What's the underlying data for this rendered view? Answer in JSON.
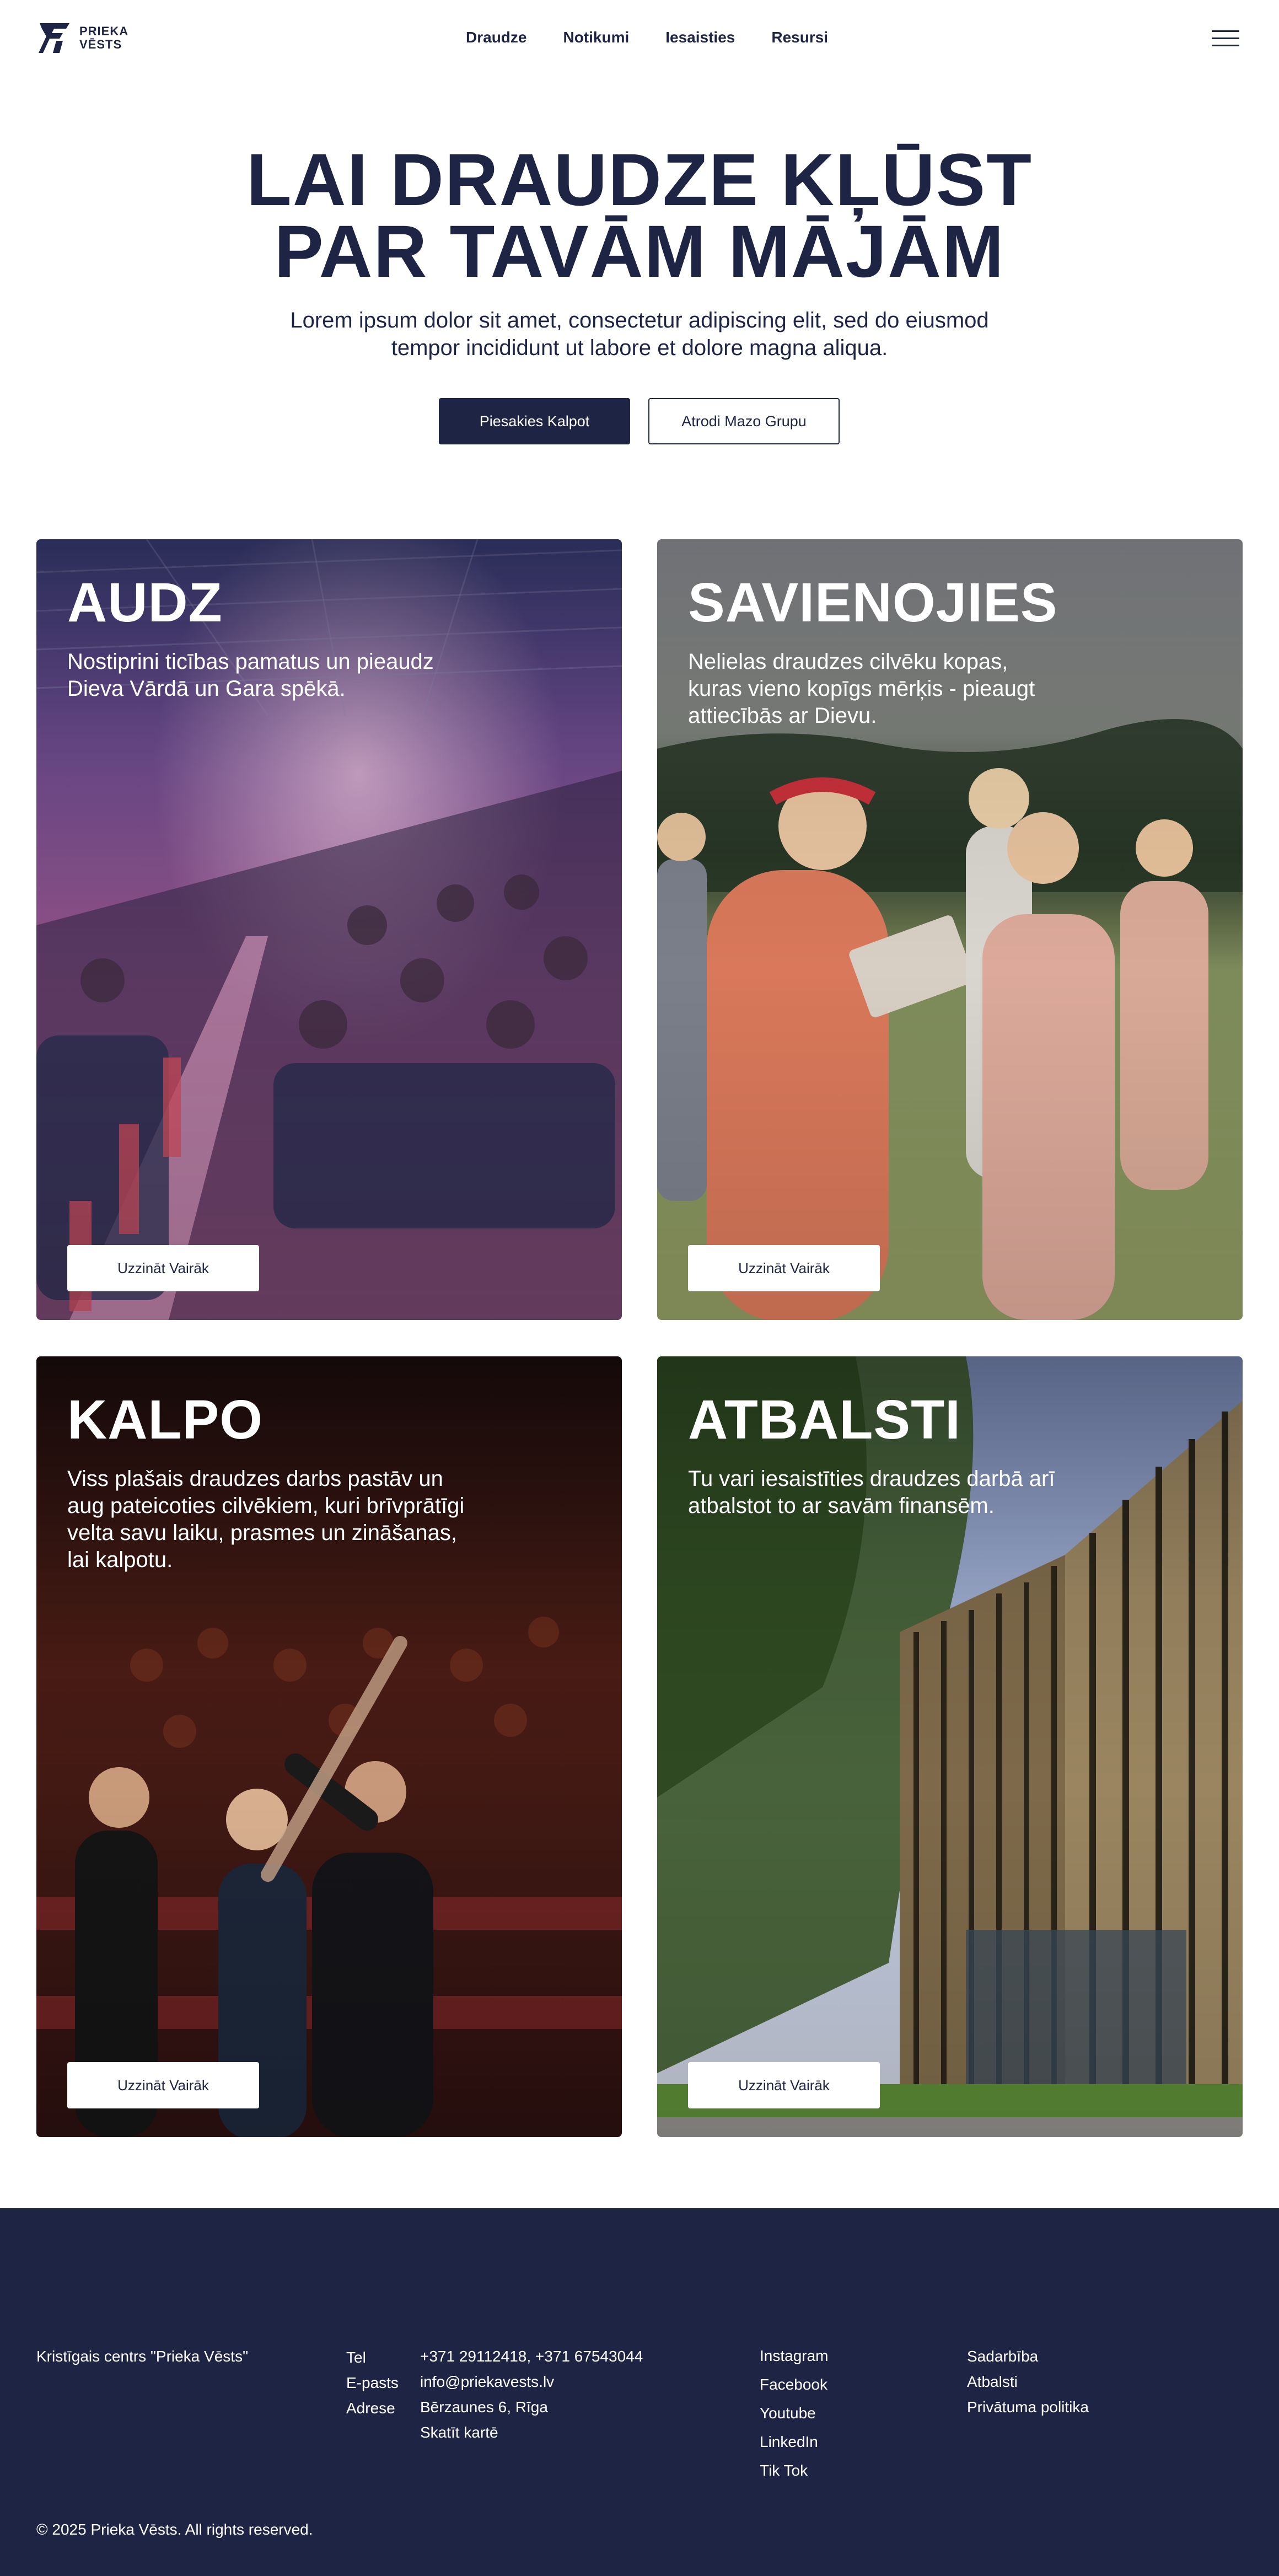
{
  "brand": {
    "logo_line1": "PRIEKA",
    "logo_line2": "VĒSTS"
  },
  "nav": {
    "items": [
      "Draudze",
      "Notikumi",
      "Iesaisties",
      "Resursi"
    ]
  },
  "hero": {
    "title_line1": "LAI DRAUDZE KĻŪST",
    "title_line2": "PAR TAVĀM MĀJĀM",
    "subtitle_line1": "Lorem ipsum dolor sit amet, consectetur adipiscing elit, sed do eiusmod",
    "subtitle_line2": "tempor incididunt ut labore et dolore magna aliqua.",
    "btn_primary": "Piesakies Kalpot",
    "btn_secondary": "Atrodi Mazo Grupu"
  },
  "cards": [
    {
      "title": "AUDZ",
      "text": "Nostiprini ticības pamatus un pieaudz Dieva Vārdā un Gara spēkā.",
      "button": "Uzzināt Vairāk"
    },
    {
      "title": "SAVIENOJIES",
      "text": "Nelielas draudzes cilvēku kopas, kuras vieno kopīgs mērķis - pieaugt attiecībās ar Dievu.",
      "button": "Uzzināt Vairāk"
    },
    {
      "title": "KALPO",
      "text": "Viss plašais draudzes darbs pastāv un aug pateicoties cilvēkiem, kuri brīvprātīgi velta savu laiku, prasmes un zināšanas, lai kalpotu.",
      "button": "Uzzināt Vairāk"
    },
    {
      "title": "ATBALSTI",
      "text": "Tu vari iesaistīties draudzes darbā arī atbalstot to ar savām finansēm.",
      "button": "Uzzināt Vairāk"
    }
  ],
  "footer": {
    "org": "Kristīgais centrs \"Prieka Vēsts\"",
    "contact_labels": [
      "Tel",
      "E-pasts",
      "Adrese"
    ],
    "phone": "+371 29112418, +371 67543044",
    "email": "info@priekavests.lv",
    "address": "Bērzaunes 6, Rīga",
    "map_link": "Skatīt kartē",
    "social": [
      "Instagram",
      "Facebook",
      "Youtube",
      "LinkedIn",
      "Tik Tok"
    ],
    "links": [
      "Sadarbība",
      "Atbalsti",
      "Privātuma politika"
    ],
    "copyright": "© 2025 Prieka Vēsts. All rights reserved."
  },
  "colors": {
    "navy": "#1e2544",
    "white": "#ffffff"
  }
}
